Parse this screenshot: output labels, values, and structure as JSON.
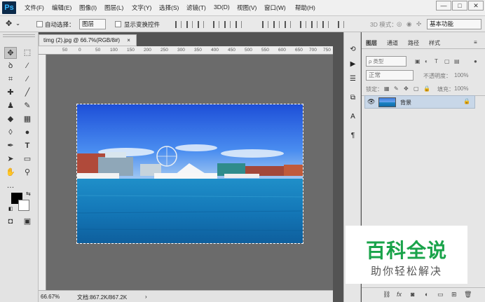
{
  "app": {
    "logo": "Ps"
  },
  "menubar": {
    "items": [
      "文件(F)",
      "编辑(E)",
      "图像(I)",
      "图层(L)",
      "文字(Y)",
      "选择(S)",
      "滤镜(T)",
      "3D(D)",
      "视图(V)",
      "窗口(W)",
      "帮助(H)"
    ]
  },
  "window_controls": {
    "minimize": "—",
    "maximize": "□",
    "close": "✕"
  },
  "options_bar": {
    "auto_select_label": "自动选择：",
    "auto_select_value": "图层",
    "show_transform_label": "显示变换控件",
    "mode_3d_label": "3D 模式：",
    "workspace": "基本功能"
  },
  "document": {
    "tab_title": "timg (2).jpg @ 66.7%(RGB/8#)",
    "tab_close": "×",
    "ruler_ticks": [
      "50",
      "0",
      "50",
      "100",
      "150",
      "200",
      "250",
      "300",
      "350",
      "400",
      "450",
      "500",
      "550",
      "600",
      "650",
      "700",
      "750"
    ]
  },
  "statusbar": {
    "zoom": "66.67%",
    "doc_size": "文档:867.2K/867.2K"
  },
  "panels": {
    "tabs": [
      "图层",
      "通道",
      "路径",
      "样式"
    ],
    "kind_filter": "ρ 类型",
    "blend_mode": "正常",
    "opacity_label": "不透明度：",
    "opacity_value": "100%",
    "lock_label": "锁定：",
    "fill_label": "填充：",
    "fill_value": "100%",
    "layer_name": "背景"
  },
  "watermark": {
    "main": "百科全说",
    "sub": "助你轻松解决"
  },
  "icons": {
    "move": "move-icon",
    "marquee": "marquee-icon",
    "lasso": "lasso-icon",
    "magic-wand": "magic-wand-icon",
    "crop": "crop-icon",
    "eyedropper": "eyedropper-icon",
    "healing": "healing-brush-icon",
    "brush": "brush-icon",
    "stamp": "clone-stamp-icon",
    "history": "history-brush-icon",
    "eraser": "eraser-icon",
    "gradient": "gradient-icon",
    "blur": "blur-icon",
    "dodge": "dodge-icon",
    "pen": "pen-icon",
    "type": "type-icon",
    "path-select": "path-selection-icon",
    "shape": "shape-icon",
    "hand": "hand-icon",
    "zoom": "zoom-icon"
  },
  "colors": {
    "accent": "#35b6ff",
    "watermark_green": "#19a34a"
  }
}
